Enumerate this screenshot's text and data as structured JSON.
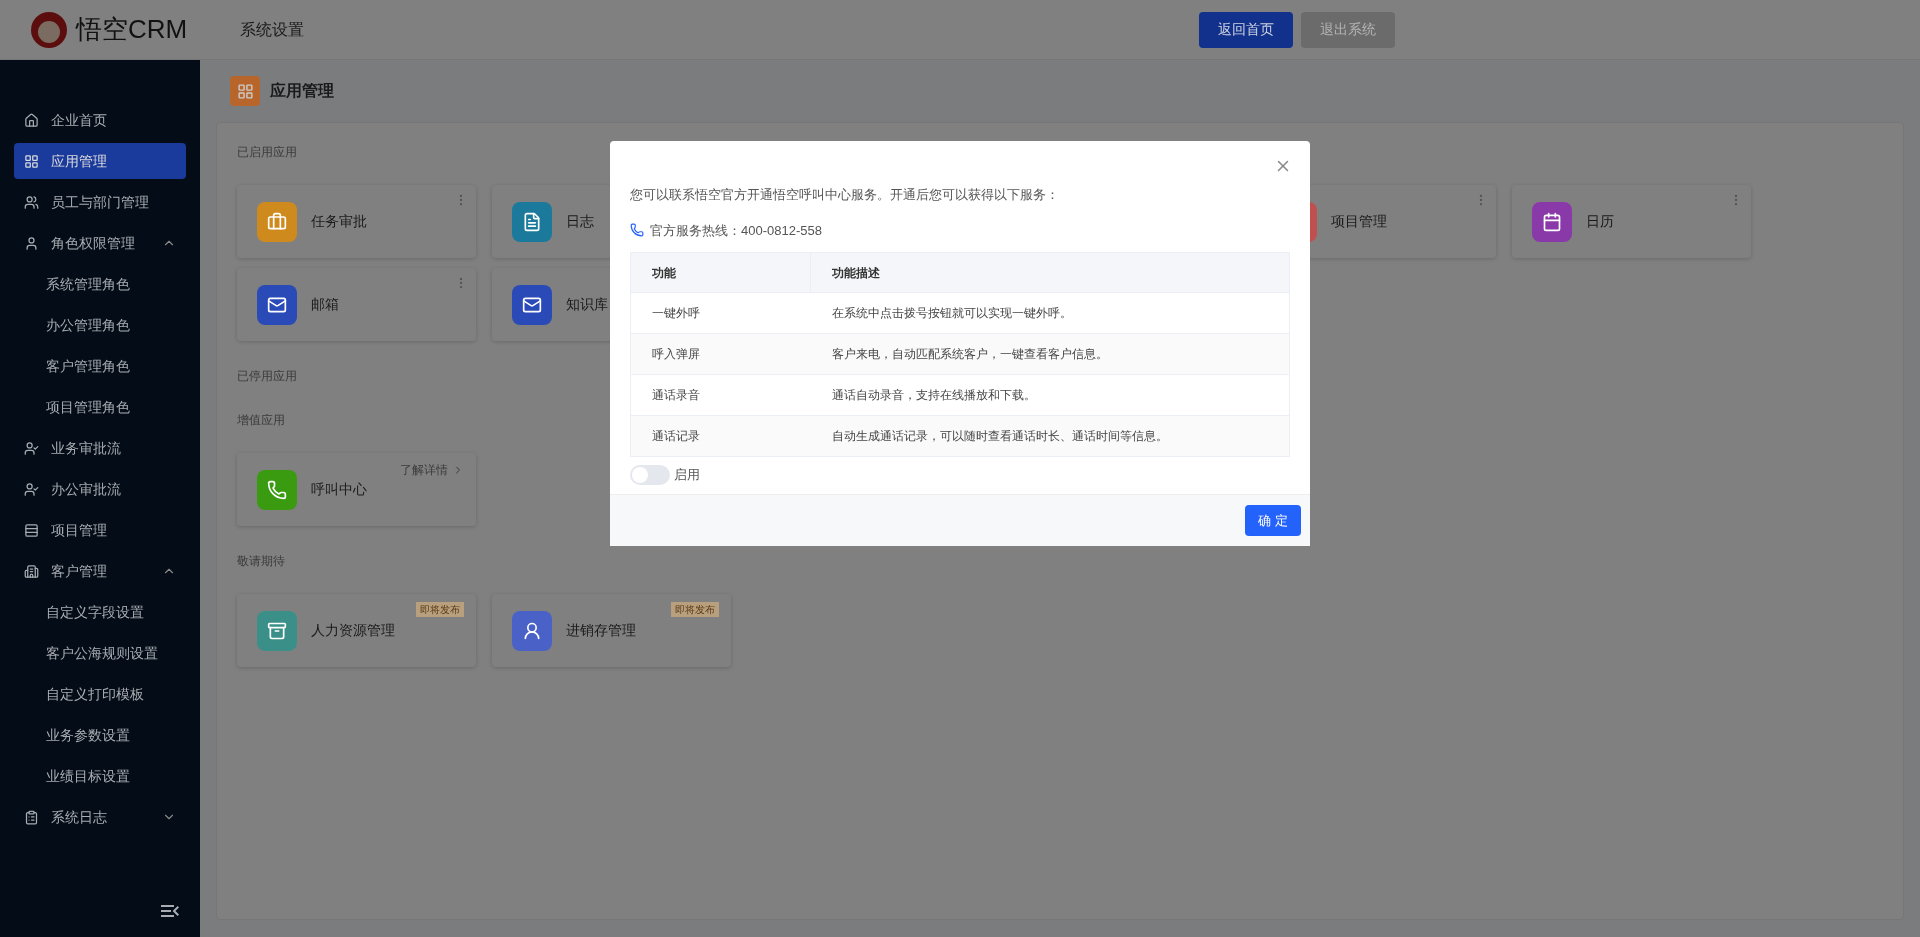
{
  "header": {
    "logo_text": "悟空CRM",
    "title": "系统设置",
    "buttons": [
      {
        "label": "返回首页",
        "kind": "primary"
      },
      {
        "label": "退出系统",
        "kind": "secondary"
      }
    ]
  },
  "sidebar": {
    "items": [
      {
        "label": "企业首页",
        "selected": false
      },
      {
        "label": "应用管理",
        "selected": true
      },
      {
        "label": "员工与部门管理",
        "selected": false
      },
      {
        "label": "角色权限管理",
        "selected": false,
        "expanded": true,
        "children": [
          {
            "label": "系统管理角色",
            "selected": false
          },
          {
            "label": "办公管理角色",
            "selected": false
          },
          {
            "label": "客户管理角色",
            "selected": false
          },
          {
            "label": "项目管理角色",
            "selected": false
          }
        ]
      },
      {
        "label": "业务审批流",
        "selected": false
      },
      {
        "label": "办公审批流",
        "selected": false
      },
      {
        "label": "项目管理",
        "selected": false
      },
      {
        "label": "客户管理",
        "selected": false,
        "expanded": true,
        "children": [
          {
            "label": "自定义字段设置",
            "selected": false
          },
          {
            "label": "客户公海规则设置",
            "selected": false
          },
          {
            "label": "自定义打印模板",
            "selected": false
          },
          {
            "label": "业务参数设置",
            "selected": false
          },
          {
            "label": "业绩目标设置",
            "selected": false
          }
        ]
      },
      {
        "label": "系统日志",
        "selected": false,
        "expanded": false
      }
    ]
  },
  "page": {
    "title": "应用管理",
    "sections": [
      {
        "title": "已启用应用",
        "rows": [
          [
            {
              "name": "任务审批",
              "kind": "enabled",
              "color": "#cf8a1e"
            },
            {
              "name": "日志",
              "kind": "enabled",
              "color": "#1b7a9c"
            },
            {
              "name": "项目管理",
              "kind": "enabled",
              "color": "#c05050"
            },
            {
              "name": "日历",
              "kind": "enabled",
              "color": "#8a3aa8"
            }
          ],
          [
            {
              "name": "邮箱",
              "kind": "enabled",
              "color": "#2a4ab8"
            },
            {
              "name": "知识库",
              "kind": "enabled",
              "color": "#2a4ab8"
            }
          ]
        ]
      },
      {
        "title": "已停用应用"
      },
      {
        "title": "增值应用",
        "rows": [
          [
            {
              "name": "呼叫中心",
              "kind": "addon",
              "color": "#3a9a10",
              "link": "了解详情"
            }
          ]
        ]
      },
      {
        "title": "敬请期待",
        "rows": [
          [
            {
              "name": "人力资源管理",
              "kind": "upcoming",
              "color": "#3a9088",
              "badge": "即将发布"
            },
            {
              "name": "进销存管理",
              "kind": "upcoming",
              "color": "#4a62c8",
              "badge": "即将发布"
            }
          ]
        ]
      }
    ]
  },
  "modal": {
    "intro": "您可以联系悟空官方开通悟空呼叫中心服务。开通后您可以获得以下服务：",
    "hotline_label": "官方服务热线：",
    "hotline": "400-0812-558",
    "table": {
      "columns": [
        "功能",
        "功能描述"
      ],
      "rows": [
        [
          "一键外呼",
          "在系统中点击拨号按钮就可以实现一键外呼。"
        ],
        [
          "呼入弹屏",
          "客户来电，自动匹配系统客户，一键查看客户信息。"
        ],
        [
          "通话录音",
          "通话自动录音，支持在线播放和下载。"
        ],
        [
          "通话记录",
          "自动生成通话记录，可以随时查看通话时长、通话时间等信息。"
        ]
      ]
    },
    "toggle": {
      "label": "启用",
      "on": false
    },
    "confirm": "确 定"
  }
}
